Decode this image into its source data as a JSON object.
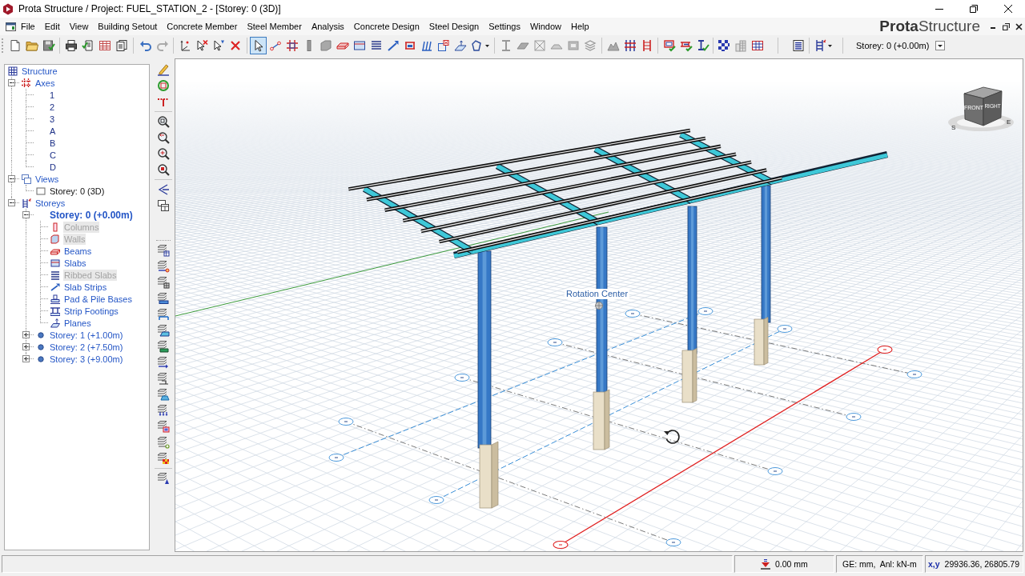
{
  "window": {
    "title": "Prota Structure / Project: FUEL_STATION_2 - [Storey: 0 (3D)]"
  },
  "menu": {
    "items": [
      "File",
      "Edit",
      "View",
      "Building Setout",
      "Concrete Member",
      "Steel Member",
      "Analysis",
      "Concrete Design",
      "Steel Design",
      "Settings",
      "Window",
      "Help"
    ],
    "brand": "**Prota**Structure"
  },
  "toolbar": {
    "groups": [
      {
        "tools": [
          {
            "selected": false
          },
          {
            "selected": false
          },
          {
            "selected": false
          }
        ]
      },
      {
        "tools": [
          {
            "selected": false
          },
          {
            "selected": false
          },
          {
            "selected": false
          },
          {
            "selected": false
          }
        ]
      },
      {
        "tools": [
          {
            "selected": false
          },
          {
            "selected": false
          }
        ]
      },
      {
        "tools": [
          {
            "selected": false
          },
          {
            "selected": false
          },
          {
            "selected": false
          },
          {
            "selected": false
          }
        ]
      },
      {
        "tools": [
          {
            "selected": true
          },
          {
            "selected": false
          },
          {
            "selected": false
          },
          {
            "selected": false
          },
          {
            "selected": false
          },
          {
            "selected": false
          },
          {
            "selected": false
          },
          {
            "selected": false
          },
          {
            "selected": false
          },
          {
            "selected": false
          },
          {
            "selected": false
          },
          {
            "selected": false
          },
          {
            "selected": false
          },
          {
            "selected": false
          }
        ]
      },
      {
        "tools": [
          {
            "selected": false
          },
          {
            "selected": false
          },
          {
            "selected": false
          },
          {
            "selected": false
          },
          {
            "selected": false
          },
          {
            "selected": false
          }
        ]
      },
      {
        "tools": [
          {
            "selected": false
          },
          {
            "selected": false
          },
          {
            "selected": false
          }
        ]
      },
      {
        "tools": [
          {
            "selected": false
          },
          {
            "selected": false
          },
          {
            "selected": false
          }
        ]
      },
      {
        "tools": [
          {
            "selected": false
          },
          {
            "selected": false
          },
          {
            "selected": false
          }
        ]
      },
      {
        "tools": [
          {
            "selected": false
          }
        ]
      },
      {
        "tools": [
          {
            "selected": false
          }
        ]
      }
    ],
    "storey_select": {
      "value": "Storey: 0 (+0.00m)"
    }
  },
  "tree": {
    "items": [
      {
        "label": "Structure",
        "kind": "structure",
        "children": [
          {
            "label": "Axes",
            "kind": "axes",
            "expanded": true,
            "children": [
              {
                "label": "1"
              },
              {
                "label": "2"
              },
              {
                "label": "3"
              },
              {
                "label": "A"
              },
              {
                "label": "B"
              },
              {
                "label": "C"
              },
              {
                "label": "D"
              }
            ]
          },
          {
            "label": "Views",
            "kind": "views",
            "expanded": true,
            "children": [
              {
                "label": "Storey: 0 (3D)",
                "kind": "view"
              }
            ]
          },
          {
            "label": "Storeys",
            "kind": "storeys",
            "expanded": true,
            "children": [
              {
                "label": "Storey: 0 (+0.00m)",
                "kind": "storey",
                "expanded": true,
                "active": true,
                "children": [
                  {
                    "label": "Columns",
                    "kind": "columns",
                    "disabled": true
                  },
                  {
                    "label": "Walls",
                    "kind": "walls",
                    "disabled": true
                  },
                  {
                    "label": "Beams",
                    "kind": "beams",
                    "disabled": false
                  },
                  {
                    "label": "Slabs",
                    "kind": "slabs",
                    "disabled": false
                  },
                  {
                    "label": "Ribbed Slabs",
                    "kind": "ribbed_slabs",
                    "disabled": true
                  },
                  {
                    "label": "Slab Strips",
                    "kind": "slab_strips",
                    "disabled": false
                  },
                  {
                    "label": "Pad & Pile Bases",
                    "kind": "pad_bases",
                    "disabled": false
                  },
                  {
                    "label": "Strip Footings",
                    "kind": "strip_footings",
                    "disabled": false
                  },
                  {
                    "label": "Planes",
                    "kind": "planes",
                    "disabled": false
                  }
                ]
              },
              {
                "label": "Storey: 1 (+1.00m)",
                "kind": "storey",
                "expanded": false,
                "active": false
              },
              {
                "label": "Storey: 2 (+7.50m)",
                "kind": "storey",
                "expanded": false,
                "active": false
              },
              {
                "label": "Storey: 3 (+9.00m)",
                "kind": "storey",
                "expanded": false,
                "active": false
              }
            ]
          }
        ]
      }
    ]
  },
  "viewport": {
    "rotation_label": "Rotation Center",
    "view_cube": {
      "faces": [
        "FRONT",
        "RIGHT"
      ],
      "compass": [
        "S",
        "E"
      ]
    }
  },
  "status_bar": {
    "panels": [
      {
        "kind": "elevation",
        "text": "0.00 mm"
      },
      {
        "kind": "units",
        "text": "GE: mm,  Anl: kN-m"
      },
      {
        "kind": "coordinates",
        "label": "x,y",
        "text": "29936.36, 26805.79"
      }
    ]
  }
}
